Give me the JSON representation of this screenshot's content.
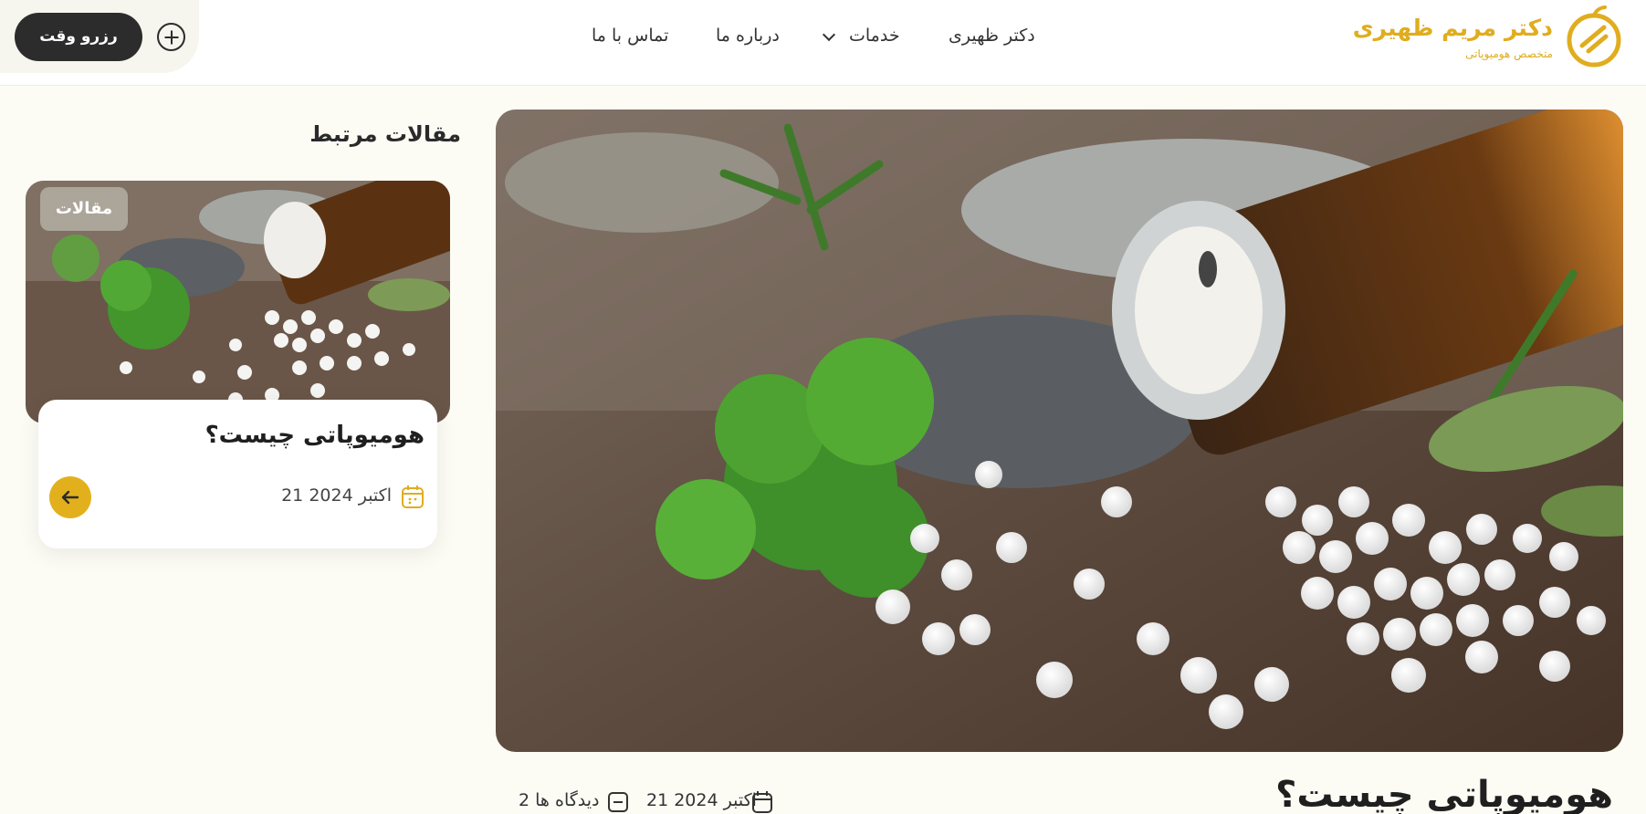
{
  "header": {
    "book_button": "رزرو وقت",
    "nav": {
      "doctor": "دکتر ظهیری",
      "services": "خدمات",
      "about": "درباره ما",
      "contact": "تماس با ما"
    },
    "logo": {
      "name": "دکتر مریم ظهیری",
      "subtitle": "متخصص هومیوپاتی"
    }
  },
  "related": {
    "title": "مقالات مرتبط",
    "card": {
      "category": "مقالات",
      "title": "هومیوپاتی چیست؟",
      "date": "21 اکتبر 2024"
    }
  },
  "post": {
    "title": "هومیوپاتی چیست؟",
    "date": "21 اکتبر 2024",
    "comments": "2 دیدگاه ها"
  },
  "colors": {
    "accent": "#e3b01d",
    "dark": "#2c2c2c",
    "background": "#fcfcf5"
  }
}
